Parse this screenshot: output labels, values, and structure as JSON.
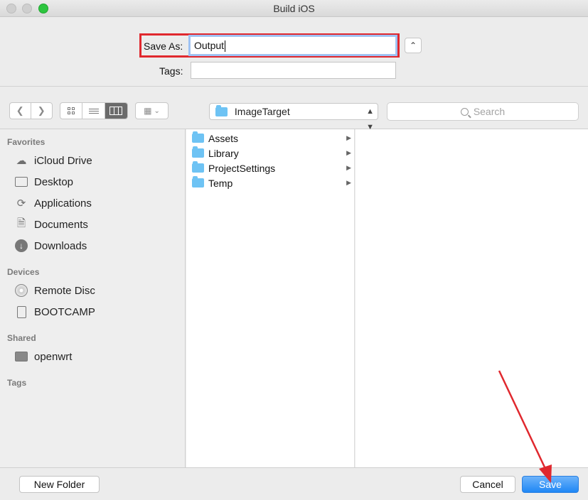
{
  "window": {
    "title": "Build iOS"
  },
  "save_panel": {
    "save_as_label": "Save As:",
    "save_as_value": "Output",
    "tags_label": "Tags:",
    "tags_value": "",
    "expand_icon": "chevron-up-icon"
  },
  "toolbar": {
    "back_icon": "chevron-left-icon",
    "forward_icon": "chevron-right-icon",
    "view_modes": [
      "icon-view",
      "list-view",
      "column-view"
    ],
    "active_view": "column-view",
    "arrange_icon": "arrange-grid-icon",
    "location": "ImageTarget",
    "search_placeholder": "Search"
  },
  "sidebar": {
    "favorites_heading": "Favorites",
    "favorites": [
      {
        "label": "iCloud Drive",
        "icon": "cloud-icon"
      },
      {
        "label": "Desktop",
        "icon": "desktop-icon"
      },
      {
        "label": "Applications",
        "icon": "applications-icon"
      },
      {
        "label": "Documents",
        "icon": "documents-icon"
      },
      {
        "label": "Downloads",
        "icon": "downloads-icon"
      }
    ],
    "devices_heading": "Devices",
    "devices": [
      {
        "label": "Remote Disc",
        "icon": "disc-icon"
      },
      {
        "label": "BOOTCAMP",
        "icon": "drive-icon"
      }
    ],
    "shared_heading": "Shared",
    "shared": [
      {
        "label": "openwrt",
        "icon": "computer-icon"
      }
    ],
    "tags_heading": "Tags"
  },
  "browser": {
    "column1": [
      {
        "label": "Assets"
      },
      {
        "label": "Library"
      },
      {
        "label": "ProjectSettings"
      },
      {
        "label": "Temp"
      }
    ]
  },
  "footer": {
    "new_folder_label": "New Folder",
    "cancel_label": "Cancel",
    "save_label": "Save"
  },
  "colors": {
    "highlight_border": "#e0282e",
    "annotation_arrow": "#e0282e",
    "accent_blue": "#1f87f5",
    "folder_blue": "#6ec3f4"
  }
}
